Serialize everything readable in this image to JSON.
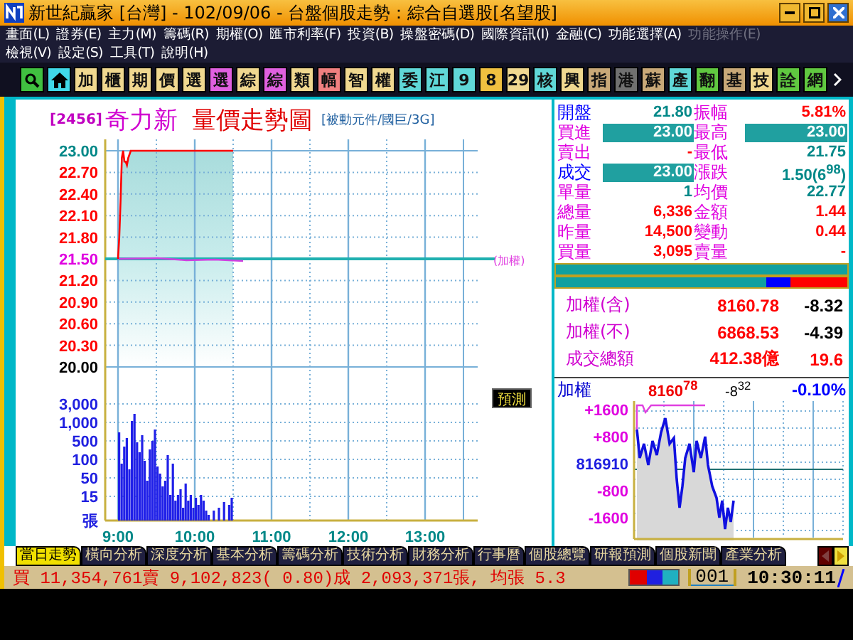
{
  "window": {
    "title": "新世紀贏家 [台灣]  - 102/09/06 - 台盤個股走勢：綜合自選股[名望股]"
  },
  "menu": {
    "rows": [
      {
        "items": [
          {
            "label": "畫面(L)",
            "disabled": false
          },
          {
            "label": "證券(E)",
            "disabled": false
          },
          {
            "label": "主力(M)",
            "disabled": false
          },
          {
            "label": "籌碼(R)",
            "disabled": false
          },
          {
            "label": "期權(O)",
            "disabled": false
          },
          {
            "label": "匯市利率(F)",
            "disabled": false
          },
          {
            "label": "投資(B)",
            "disabled": false
          },
          {
            "label": "操盤密碼(D)",
            "disabled": false
          },
          {
            "label": "國際資訊(I)",
            "disabled": false
          },
          {
            "label": "金融(C)",
            "disabled": false
          },
          {
            "label": "功能選擇(A)",
            "disabled": false
          },
          {
            "label": "功能操作(E)",
            "disabled": true
          }
        ]
      },
      {
        "items": [
          {
            "label": "檢視(V)",
            "disabled": false
          },
          {
            "label": "設定(S)",
            "disabled": false
          },
          {
            "label": "工具(T)",
            "disabled": false
          },
          {
            "label": "說明(H)",
            "disabled": false
          }
        ]
      }
    ]
  },
  "toolbar": {
    "buttons": [
      {
        "kind": "search",
        "color": "#40c040"
      },
      {
        "kind": "home",
        "color": "#40d8e8"
      },
      {
        "kind": "text",
        "label": "加",
        "color": "#f0d890"
      },
      {
        "kind": "text",
        "label": "櫃",
        "color": "#f0d890"
      },
      {
        "kind": "text",
        "label": "期",
        "color": "#f0d890"
      },
      {
        "kind": "text",
        "label": "價",
        "color": "#f0d890"
      },
      {
        "kind": "text",
        "label": "選",
        "color": "#f0d890"
      },
      {
        "kind": "text",
        "label": "選",
        "color": "#e060e0"
      },
      {
        "kind": "text",
        "label": "綜",
        "color": "#f0d890"
      },
      {
        "kind": "text",
        "label": "綜",
        "color": "#e060e0"
      },
      {
        "kind": "text",
        "label": "類",
        "color": "#f0d890"
      },
      {
        "kind": "text",
        "label": "幅",
        "color": "#f08080"
      },
      {
        "kind": "text",
        "label": "智",
        "color": "#f0d890"
      },
      {
        "kind": "text",
        "label": "權",
        "color": "#f0d890"
      },
      {
        "kind": "text",
        "label": "委",
        "color": "#60d8d8"
      },
      {
        "kind": "text",
        "label": "江",
        "color": "#60d8d8"
      },
      {
        "kind": "text",
        "label": "9",
        "color": "#60d8d8"
      },
      {
        "kind": "text",
        "label": "8",
        "color": "#f0c040"
      },
      {
        "kind": "text",
        "label": "29",
        "color": "#f0d890"
      },
      {
        "kind": "text",
        "label": "核",
        "color": "#60d8d8"
      },
      {
        "kind": "text",
        "label": "興",
        "color": "#f0d890"
      },
      {
        "kind": "text",
        "label": "指",
        "color": "#c8a878"
      },
      {
        "kind": "text",
        "label": "港",
        "color": "#707070"
      },
      {
        "kind": "text",
        "label": "蘇",
        "color": "#c8a878"
      },
      {
        "kind": "text",
        "label": "產",
        "color": "#60d8d8"
      },
      {
        "kind": "text",
        "label": "翻",
        "color": "#60c840"
      },
      {
        "kind": "text",
        "label": "基",
        "color": "#c8a878"
      },
      {
        "kind": "text",
        "label": "技",
        "color": "#f0d890"
      },
      {
        "kind": "text",
        "label": "詮",
        "color": "#60c840"
      },
      {
        "kind": "text",
        "label": "網",
        "color": "#60c840"
      },
      {
        "kind": "more",
        "color": "#101020"
      }
    ]
  },
  "price_chart": {
    "code": "[2456]",
    "name": "奇力新",
    "title": "量價走勢圖",
    "category": "[被動元件/國巨/3G]",
    "price_labels": [
      {
        "text": "23.00",
        "color": "#008888"
      },
      {
        "text": "22.70",
        "color": "#ff0000"
      },
      {
        "text": "22.40",
        "color": "#ff0000"
      },
      {
        "text": "22.10",
        "color": "#ff0000"
      },
      {
        "text": "21.80",
        "color": "#ff0000"
      },
      {
        "text": "21.50",
        "color": "#e000e0"
      },
      {
        "text": "21.20",
        "color": "#ff0000"
      },
      {
        "text": "20.90",
        "color": "#ff0000"
      },
      {
        "text": "20.60",
        "color": "#ff0000"
      },
      {
        "text": "20.30",
        "color": "#ff0000"
      },
      {
        "text": "20.00",
        "color": "#000000"
      }
    ],
    "legend": "(加權)",
    "time_labels": [
      "9:00",
      "10:00",
      "11:00",
      "12:00",
      "13:00"
    ]
  },
  "volume_chart": {
    "labels": [
      "3,000",
      "1,000",
      "500",
      "100",
      "50",
      "15"
    ],
    "unit": "張",
    "button": "預測"
  },
  "quote": {
    "rows": [
      {
        "cells": [
          {
            "label": {
              "text": "開盤",
              "color": "#0000ff"
            },
            "value": {
              "text": "21.80",
              "color": "#008888",
              "highlighted": false
            }
          },
          {
            "label": {
              "text": "振幅",
              "color": "#e000e0"
            },
            "value": {
              "text": "5.81%",
              "color": "#ff0000",
              "highlighted": false
            }
          }
        ]
      },
      {
        "cells": [
          {
            "label": {
              "text": "買進",
              "color": "#e000e0"
            },
            "value": {
              "text": "23.00",
              "highlighted": true
            }
          },
          {
            "label": {
              "text": "最高",
              "color": "#e000e0"
            },
            "value": {
              "text": "23.00",
              "highlighted": true
            }
          }
        ]
      },
      {
        "cells": [
          {
            "label": {
              "text": "賣出",
              "color": "#e000e0"
            },
            "value": {
              "text": "-",
              "color": "#ff0000",
              "highlighted": false
            }
          },
          {
            "label": {
              "text": "最低",
              "color": "#e000e0"
            },
            "value": {
              "text": "21.75",
              "color": "#008888",
              "highlighted": false
            }
          }
        ]
      },
      {
        "cells": [
          {
            "label": {
              "text": "成交",
              "color": "#0000ff"
            },
            "value": {
              "text": "23.00",
              "highlighted": true
            }
          },
          {
            "label": {
              "text": "漲跌",
              "color": "#e000e0"
            },
            "value": {
              "text": "1.50(6$^{98}$)",
              "color": "#008888",
              "highlighted": false
            }
          }
        ]
      },
      {
        "cells": [
          {
            "label": {
              "text": "單量",
              "color": "#e000e0"
            },
            "value": {
              "text": "1",
              "color": "#008888",
              "highlighted": false
            }
          },
          {
            "label": {
              "text": "均價",
              "color": "#e000e0"
            },
            "value": {
              "text": "22.77",
              "color": "#008888",
              "highlighted": false
            }
          }
        ]
      },
      {
        "cells": [
          {
            "label": {
              "text": "總量",
              "color": "#e000e0"
            },
            "value": {
              "text": "6,336",
              "color": "#ff0000",
              "highlighted": false
            }
          },
          {
            "label": {
              "text": "金額",
              "color": "#e000e0"
            },
            "value": {
              "text": "1.44",
              "color": "#ff0000",
              "highlighted": false
            }
          }
        ]
      },
      {
        "cells": [
          {
            "label": {
              "text": "昨量",
              "color": "#e000e0"
            },
            "value": {
              "text": "14,500",
              "color": "#ff0000",
              "highlighted": false
            }
          },
          {
            "label": {
              "text": "變動",
              "color": "#e000e0"
            },
            "value": {
              "text": "0.44",
              "color": "#ff0000",
              "highlighted": false
            }
          }
        ]
      },
      {
        "cells": [
          {
            "label": {
              "text": "買量",
              "color": "#e000e0"
            },
            "value": {
              "text": "3,095",
              "color": "#ff0000",
              "highlighted": false
            }
          },
          {
            "label": {
              "text": "賣量",
              "color": "#e000e0"
            },
            "value": {
              "text": "-",
              "color": "#ff0000",
              "highlighted": false
            }
          }
        ]
      }
    ]
  },
  "strength_bar": {
    "level": 0.28
  },
  "indices": [
    {
      "label": "加權(含)",
      "value": "8160.78",
      "change": "-8.32",
      "color": "#000000"
    },
    {
      "label": "加權(不)",
      "value": "6868.53",
      "change": "-4.39",
      "color": "#000000"
    },
    {
      "label": "成交總額",
      "value": "412.38億",
      "change": "19.6",
      "color": "#ff0000"
    }
  ],
  "index_chart": {
    "label": "加權",
    "value": "8160$^{78}$",
    "change": "-8$^{32}$",
    "percent": "-0.10%",
    "axis_labels": [
      {
        "text": "+1600",
        "kind": "offset"
      },
      {
        "text": "+800",
        "kind": "offset"
      },
      {
        "text": "816910",
        "kind": "base"
      },
      {
        "text": "-800",
        "kind": "offset"
      },
      {
        "text": "-1600",
        "kind": "offset"
      }
    ]
  },
  "tabs": [
    {
      "label": "當日走勢",
      "selected": true
    },
    {
      "label": "橫向分析",
      "selected": false
    },
    {
      "label": "深度分析",
      "selected": false
    },
    {
      "label": "基本分析",
      "selected": false
    },
    {
      "label": "籌碼分析",
      "selected": false
    },
    {
      "label": "技術分析",
      "selected": false
    },
    {
      "label": "財務分析",
      "selected": false
    },
    {
      "label": "行事曆",
      "selected": false
    },
    {
      "label": "個股總覽",
      "selected": false
    },
    {
      "label": "研報預測",
      "selected": false
    },
    {
      "label": "個股新聞",
      "selected": false
    },
    {
      "label": "產業分析",
      "selected": false
    }
  ],
  "status_bar": {
    "summary": "買 11,354,761賣 9,102,823( 0.80)成 2,093,371張, 均張 5.3",
    "page": "001",
    "time": "10:30:11"
  }
}
